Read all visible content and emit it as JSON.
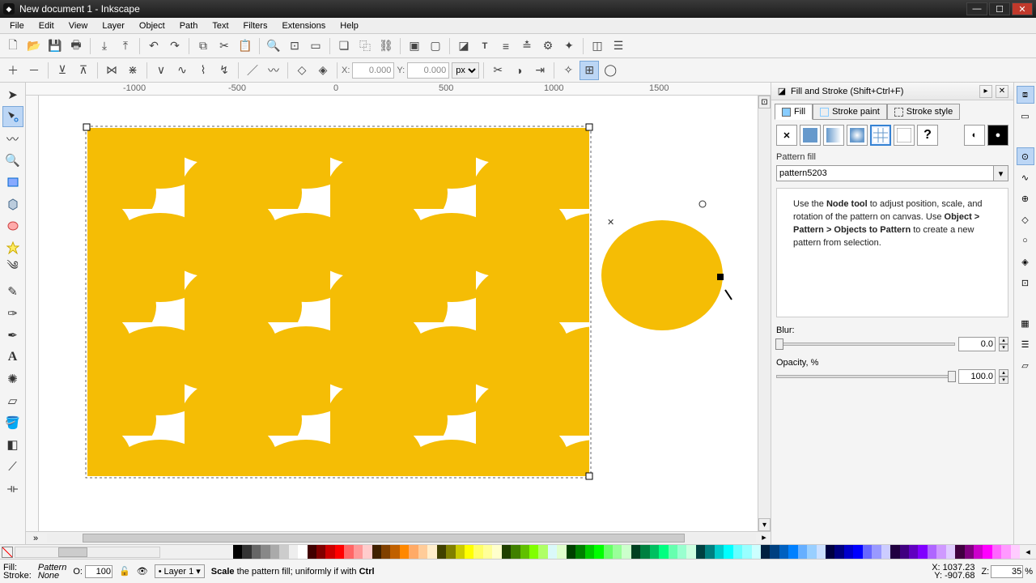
{
  "window": {
    "title": "New document 1 - Inkscape"
  },
  "menu": {
    "items": [
      "File",
      "Edit",
      "View",
      "Layer",
      "Object",
      "Path",
      "Text",
      "Filters",
      "Extensions",
      "Help"
    ]
  },
  "optionbar": {
    "x_label": "X:",
    "x_value": "0.000",
    "y_label": "Y:",
    "y_value": "0.000",
    "unit": "px"
  },
  "ruler_marks": [
    "-1000",
    "-500",
    "0",
    "500",
    "1000",
    "1500"
  ],
  "panel": {
    "title": "Fill and Stroke (Shift+Ctrl+F)",
    "tabs": {
      "fill": "Fill",
      "stroke_paint": "Stroke paint",
      "stroke_style": "Stroke style"
    },
    "section_label": "Pattern fill",
    "pattern_name": "pattern5203",
    "hint_pre": "Use the ",
    "hint_node": "Node tool",
    "hint_mid1": " to adjust position, scale, and rotation of the pattern on canvas. Use ",
    "hint_menu": "Object > Pattern > Objects to Pattern",
    "hint_post": " to create a new pattern from selection.",
    "blur_label": "Blur:",
    "blur_value": "0.0",
    "opacity_label": "Opacity, %",
    "opacity_value": "100.0"
  },
  "status": {
    "fill_label": "Fill:",
    "stroke_label": "Stroke:",
    "fill_value": "Pattern",
    "stroke_value": "None",
    "o_label": "O:",
    "o_value": "100",
    "layer": "Layer 1",
    "msg_bold": "Scale",
    "msg_rest": " the pattern fill; uniformly if with ",
    "msg_ctrl": "Ctrl",
    "x_label": "X:",
    "x_value": "1037.23",
    "y_label": "Y:",
    "y_value": "-907.68",
    "z_label": "Z:",
    "z_value": "35",
    "z_pct": "%"
  },
  "palette_colors": [
    "#000",
    "#333",
    "#666",
    "#888",
    "#aaa",
    "#ccc",
    "#eee",
    "#fff",
    "#400000",
    "#800000",
    "#c00",
    "#f00",
    "#f66",
    "#f99",
    "#fcc",
    "#402000",
    "#804000",
    "#c06000",
    "#f80",
    "#fa6",
    "#fc9",
    "#fec",
    "#404000",
    "#808000",
    "#cc0",
    "#ff0",
    "#ff6",
    "#ff9",
    "#ffc",
    "#204000",
    "#408000",
    "#60c000",
    "#80ff00",
    "#afff66",
    "#cff9",
    "#e0ffcc",
    "#004000",
    "#008000",
    "#0c0",
    "#0f0",
    "#6f6",
    "#9f9",
    "#cfc",
    "#004020",
    "#008040",
    "#00c060",
    "#00ff80",
    "#66ffaf",
    "#99ffcf",
    "#ccffe0",
    "#004040",
    "#008080",
    "#0cc",
    "#0ff",
    "#6ff",
    "#9ff",
    "#cff",
    "#002040",
    "#004080",
    "#0060c0",
    "#0080ff",
    "#66afff",
    "#99cfff",
    "#cce0ff",
    "#000040",
    "#000080",
    "#00c",
    "#00f",
    "#66f",
    "#99f",
    "#ccf",
    "#200040",
    "#400080",
    "#6000c0",
    "#8000ff",
    "#af66ff",
    "#cf99ff",
    "#e0ccff",
    "#400040",
    "#800080",
    "#c0c",
    "#f0f",
    "#f6f",
    "#f9f",
    "#fcf"
  ]
}
